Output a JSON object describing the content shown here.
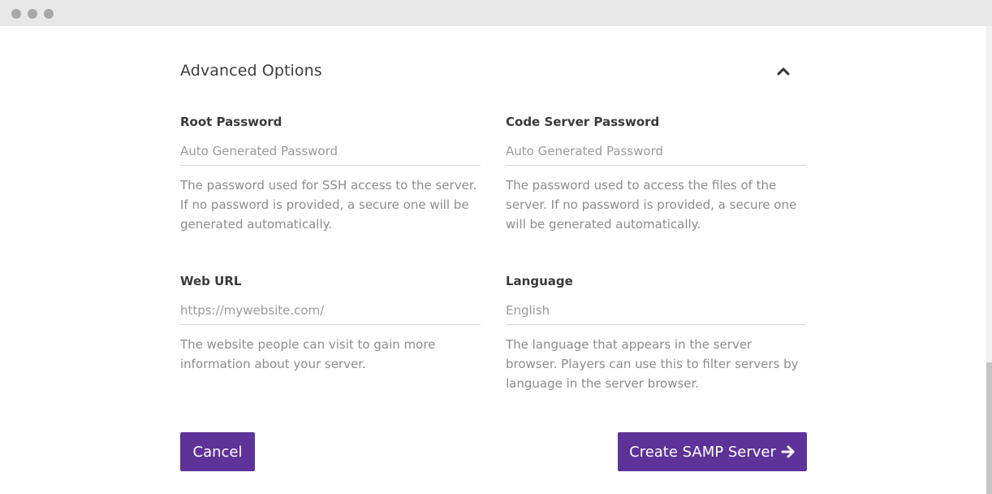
{
  "window": {
    "controls": [
      "close-dot",
      "minimize-dot",
      "maximize-dot"
    ]
  },
  "section": {
    "title": "Advanced Options",
    "toggle_icon": "chevron-up-icon"
  },
  "fields": {
    "root_password": {
      "label": "Root Password",
      "value": "",
      "placeholder": "Auto Generated Password",
      "help": "The password used for SSH access to the server. If no password is provided, a secure one will be generated automatically."
    },
    "code_server_password": {
      "label": "Code Server Password",
      "value": "",
      "placeholder": "Auto Generated Password",
      "help": "The password used to access the files of the server. If no password is provided, a secure one will be generated automatically."
    },
    "web_url": {
      "label": "Web URL",
      "value": "",
      "placeholder": "https://mywebsite.com/",
      "help": "The website people can visit to gain more information about your server."
    },
    "language": {
      "label": "Language",
      "value": "",
      "placeholder": "English",
      "help": "The language that appears in the server browser. Players can use this to filter servers by language in the server browser."
    }
  },
  "actions": {
    "cancel_label": "Cancel",
    "create_label": "Create SAMP Server",
    "create_icon": "arrow-right-icon"
  },
  "colors": {
    "primary": "#5e3299",
    "label": "#3a3a3a",
    "help": "#8c8c8c",
    "placeholder": "#9a9a9a",
    "divider": "#d8d8d8"
  }
}
